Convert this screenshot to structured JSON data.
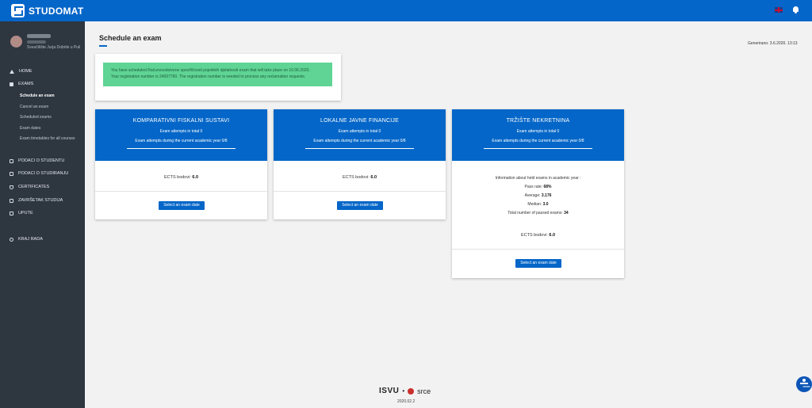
{
  "header": {
    "app_name": "STUDOMAT",
    "language": "English",
    "colors": {
      "brand": "#0466c8",
      "sidebar": "#2e3640",
      "notice": "#5fd494"
    }
  },
  "user": {
    "faculty": "Sveučilište Jurja Dobrile u Puli"
  },
  "sidebar": {
    "items": [
      {
        "label": "HOME",
        "icon": "home-icon"
      },
      {
        "label": "EXAMS",
        "icon": "exams-icon"
      },
      {
        "label": "PODACI O STUDENTU",
        "icon": "student-data-icon"
      },
      {
        "label": "PODACI O STUDIRANJU",
        "icon": "study-data-icon"
      },
      {
        "label": "CERTIFICATES",
        "icon": "certificates-icon"
      },
      {
        "label": "ZAVRŠETAK STUDIJA",
        "icon": "graduation-icon"
      },
      {
        "label": "UPUTE",
        "icon": "instructions-icon"
      },
      {
        "label": "KRAJ RADA",
        "icon": "logout-icon"
      }
    ],
    "sub_items": [
      {
        "label": "Schedule an exam",
        "active": true
      },
      {
        "label": "Cancel an exam",
        "active": false
      },
      {
        "label": "Scheduled exams",
        "active": false
      },
      {
        "label": "Exam dates",
        "active": false
      },
      {
        "label": "Exam timetables for all courses",
        "active": false
      }
    ]
  },
  "main": {
    "title": "Schedule an exam",
    "generated": "Generirano: 3.6.2020. 13:13",
    "notice": {
      "line1": "You have scheduled Računovodstvene specifičnosti pojedinih djelatnosti exam that will take place on 10.06.2020.",
      "line2": "Your registration number is 24937760. The registration number is needed to process any reclamation requests."
    },
    "courses": [
      {
        "name": "KOMPARATIVNI FISKALNI SUSTAVI",
        "attempts_total": "Exam attempts in total 0",
        "attempts_year": "Exam attempts during the current academic year 0/8",
        "ects_label": "ECTS bodovi:",
        "ects_value": "6.0",
        "button": "Select an exam date"
      },
      {
        "name": "LOKALNE JAVNE FINANCIJE",
        "attempts_total": "Exam attempts in total 0",
        "attempts_year": "Exam attempts during the current academic year 0/8",
        "ects_label": "ECTS bodovi:",
        "ects_value": "6.0",
        "button": "Select an exam date"
      },
      {
        "name": "TRŽIŠTE NEKRETNINA",
        "attempts_total": "Exam attempts in total 0",
        "attempts_year": "Exam attempts during the current academic year 0/8",
        "info_title": "Information about held exams in academic year :",
        "pass_rate_label": "Pass rate:",
        "pass_rate_value": "68%",
        "average_label": "Average:",
        "average_value": "3.176",
        "median_label": "Median:",
        "median_value": "3.0",
        "passed_label": "Total number of passed exams:",
        "passed_value": "34",
        "ects_label": "ECTS bodovi:",
        "ects_value": "6.0",
        "button": "Select an exam date"
      }
    ]
  },
  "footer": {
    "logo_isvu": "ISVU",
    "separator": "•",
    "logo_srce": "srce",
    "version": "2020.02.2"
  }
}
